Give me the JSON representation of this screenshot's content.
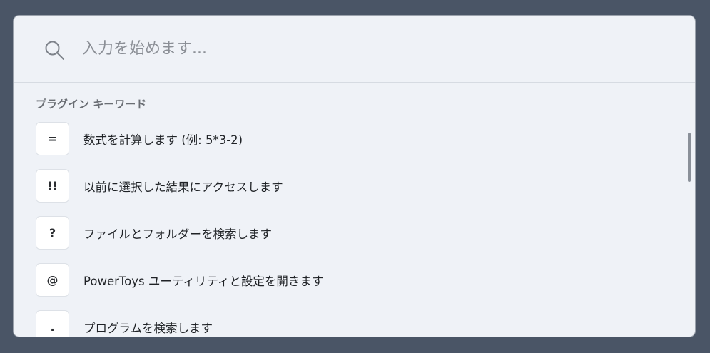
{
  "search": {
    "placeholder": "入力を始めます..."
  },
  "section": {
    "title": "プラグイン キーワード"
  },
  "items": [
    {
      "key": "=",
      "label": "数式を計算します (例: 5*3-2)"
    },
    {
      "key": "!!",
      "label": "以前に選択した結果にアクセスします"
    },
    {
      "key": "?",
      "label": "ファイルとフォルダーを検索します"
    },
    {
      "key": "@",
      "label": "PowerToys ユーティリティと設定を開きます"
    },
    {
      "key": ".",
      "label": "プログラムを検索します"
    }
  ],
  "colors": {
    "window_bg": "#eff2f7",
    "desktop_bg": "#4a5566",
    "accent_text": "#1f2226"
  }
}
